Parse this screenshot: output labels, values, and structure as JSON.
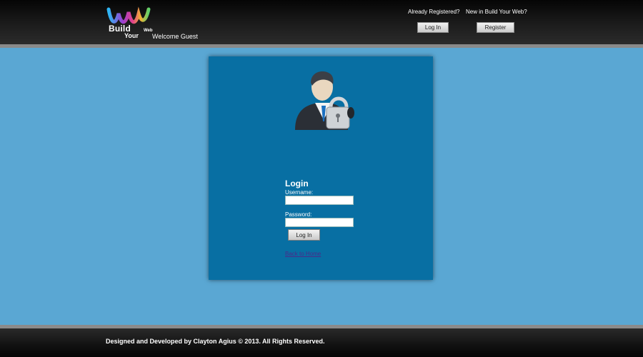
{
  "header": {
    "logo": {
      "word_build": "Build",
      "word_your": "Your",
      "word_web": "Web"
    },
    "welcome_text": "Welcome Guest",
    "already_registered_label": "Already Registered?",
    "new_label": "New in Build Your Web?",
    "login_button": "Log In",
    "register_button": "Register"
  },
  "login": {
    "avatar_icon": "user-lock-icon",
    "title": "Login",
    "username_label": "Username:",
    "username_value": "",
    "password_label": "Password:",
    "password_value": "",
    "login_button": "Log In",
    "back_link": "Back to Home"
  },
  "footer": {
    "copyright": "Designed and Developed by Clayton Agius © 2013. All Rights Reserved."
  },
  "colors": {
    "page_background": "#5aa7d3",
    "panel_background": "#086fa3",
    "header_background": "#111111",
    "link_color": "#4b2a8a"
  }
}
